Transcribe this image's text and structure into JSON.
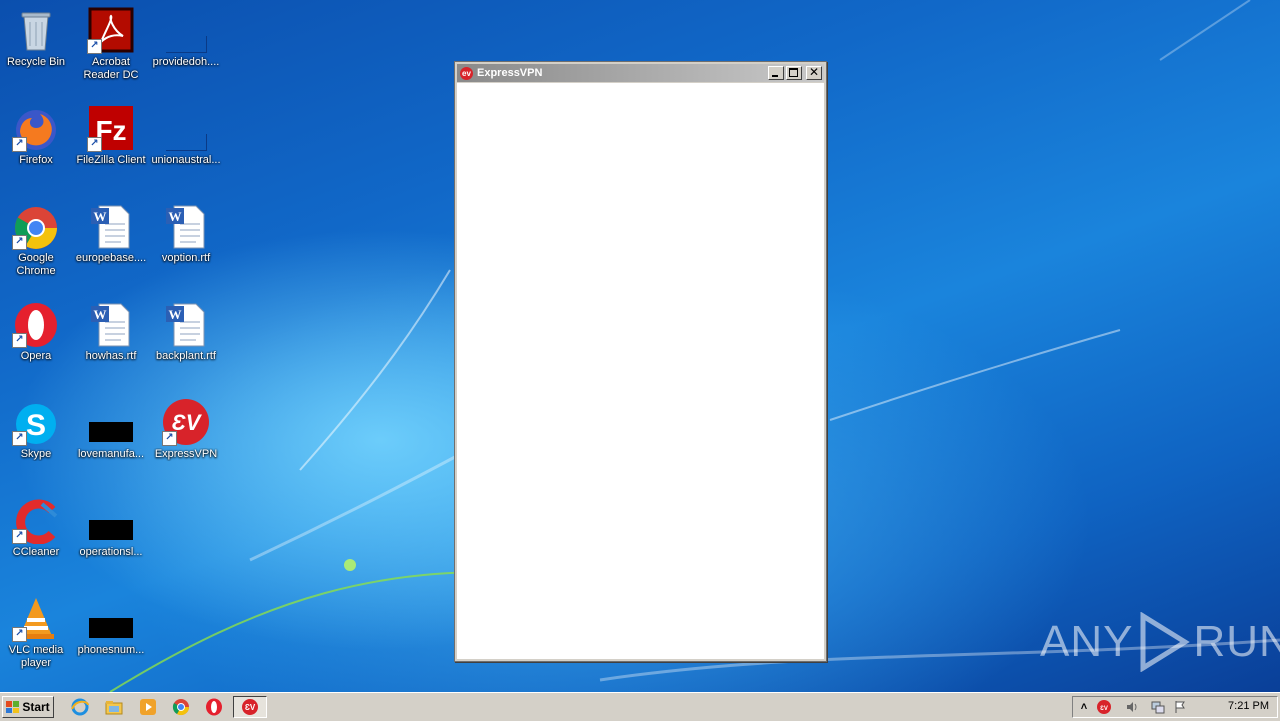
{
  "desktop_icons": [
    {
      "label": "Recycle Bin",
      "icon": "recycle-bin-icon"
    },
    {
      "label": "Acrobat Reader DC",
      "icon": "acrobat-icon"
    },
    {
      "label": "providedoh....",
      "icon": "blank-file-icon"
    },
    {
      "label": "Firefox",
      "icon": "firefox-icon"
    },
    {
      "label": "FileZilla Client",
      "icon": "filezilla-icon"
    },
    {
      "label": "unionaustral...",
      "icon": "blank-file-icon"
    },
    {
      "label": "Google Chrome",
      "icon": "chrome-icon"
    },
    {
      "label": "europebase....",
      "icon": "word-doc-icon"
    },
    {
      "label": "voption.rtf",
      "icon": "word-doc-icon"
    },
    {
      "label": "Opera",
      "icon": "opera-icon"
    },
    {
      "label": "howhas.rtf",
      "icon": "word-doc-icon"
    },
    {
      "label": "backplant.rtf",
      "icon": "word-doc-icon"
    },
    {
      "label": "Skype",
      "icon": "skype-icon"
    },
    {
      "label": "lovemanufa...",
      "icon": "black-file-icon"
    },
    {
      "label": "ExpressVPN",
      "icon": "expressvpn-icon"
    },
    {
      "label": "CCleaner",
      "icon": "ccleaner-icon"
    },
    {
      "label": "operationsl...",
      "icon": "black-file-icon"
    },
    {
      "label": "VLC media player",
      "icon": "vlc-icon"
    },
    {
      "label": "phonesnum...",
      "icon": "black-file-icon"
    }
  ],
  "window": {
    "title": "ExpressVPN",
    "app_icon_text": "ev"
  },
  "taskbar": {
    "start_label": "Start",
    "clock": "7:21 PM"
  },
  "watermark": {
    "text_left": "ANY",
    "text_right": "RUN"
  },
  "colors": {
    "expressvpn_red": "#d8232a",
    "taskbar_gray": "#d4d0c8"
  }
}
